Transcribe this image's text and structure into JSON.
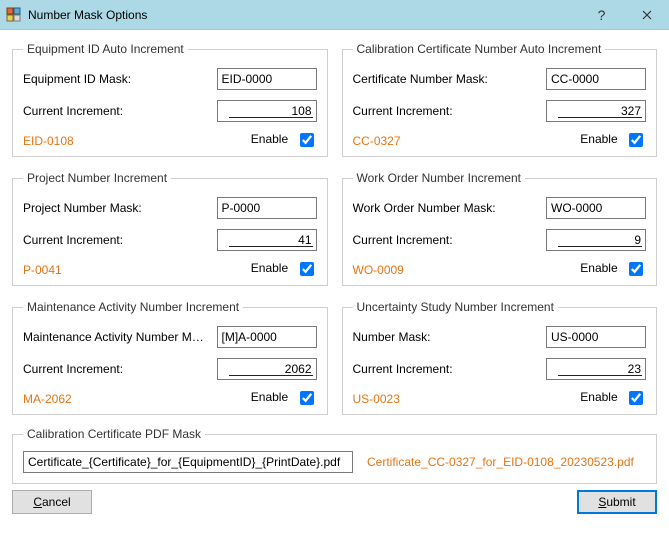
{
  "window": {
    "title": "Number Mask Options"
  },
  "groups": {
    "equip": {
      "title": "Equipment ID Auto Increment",
      "mask_label": "Equipment ID Mask:",
      "mask_value": "EID-0000",
      "inc_label": "Current Increment:",
      "inc_value": "108",
      "preview": "EID-0108",
      "enable_label": "Enable",
      "enable": true
    },
    "cert": {
      "title": "Calibration Certificate Number Auto Increment",
      "mask_label": "Certificate Number Mask:",
      "mask_value": "CC-0000",
      "inc_label": "Current Increment:",
      "inc_value": "327",
      "preview": "CC-0327",
      "enable_label": "Enable",
      "enable": true
    },
    "project": {
      "title": "Project Number Increment",
      "mask_label": "Project Number Mask:",
      "mask_value": "P-0000",
      "inc_label": "Current Increment:",
      "inc_value": "41",
      "preview": "P-0041",
      "enable_label": "Enable",
      "enable": true
    },
    "wo": {
      "title": "Work Order Number Increment",
      "mask_label": "Work Order Number Mask:",
      "mask_value": "WO-0000",
      "inc_label": "Current Increment:",
      "inc_value": "9",
      "preview": "WO-0009",
      "enable_label": "Enable",
      "enable": true
    },
    "maint": {
      "title": "Maintenance Activity Number Increment",
      "mask_label": "Maintenance Activity Number Mas...",
      "mask_value": "[M]A-0000",
      "inc_label": "Current Increment:",
      "inc_value": "2062",
      "preview": "MA-2062",
      "enable_label": "Enable",
      "enable": true
    },
    "unc": {
      "title": "Uncertainty Study Number Increment",
      "mask_label": "Number Mask:",
      "mask_value": "US-0000",
      "inc_label": "Current Increment:",
      "inc_value": "23",
      "preview": "US-0023",
      "enable_label": "Enable",
      "enable": true
    },
    "pdf": {
      "title": "Calibration Certificate PDF Mask",
      "value": "Certificate_{Certificate}_for_{EquipmentID}_{PrintDate}.pdf",
      "preview": "Certificate_CC-0327_for_EID-0108_20230523.pdf"
    }
  },
  "buttons": {
    "cancel": "Cancel",
    "submit": "Submit"
  }
}
